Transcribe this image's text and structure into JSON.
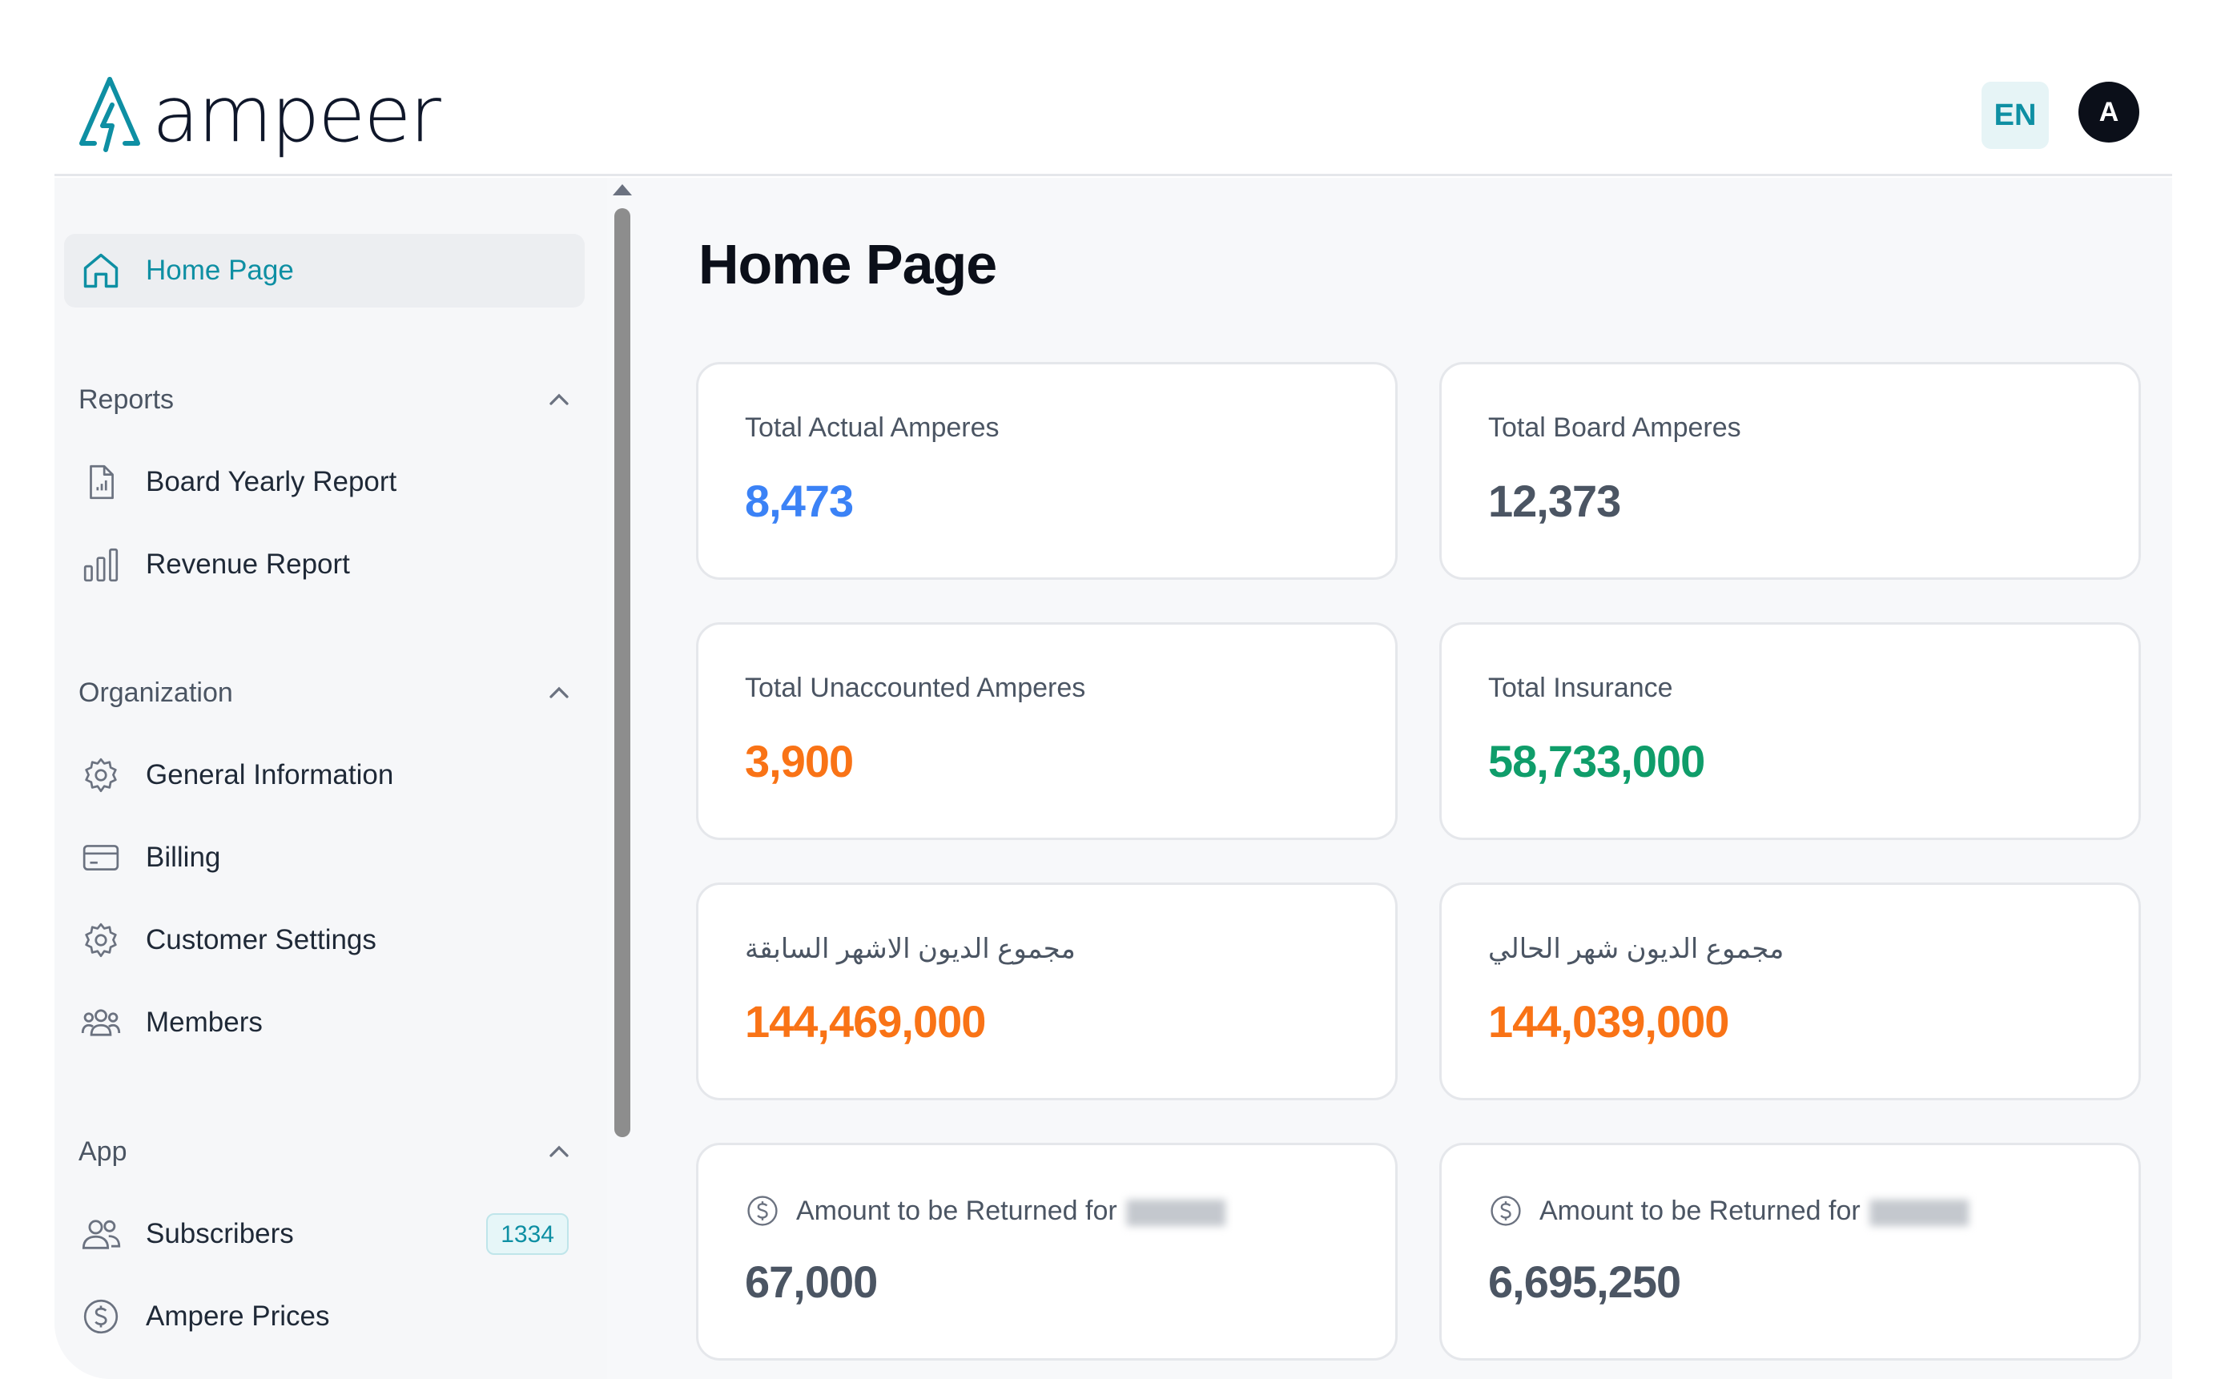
{
  "header": {
    "logo_text": "ampeer",
    "lang": "EN",
    "avatar_initial": "A"
  },
  "sidebar": {
    "home": "Home Page",
    "sections": [
      {
        "title": "Reports",
        "items": [
          {
            "label": "Board Yearly Report",
            "icon": "report-file-icon"
          },
          {
            "label": "Revenue Report",
            "icon": "bar-chart-icon"
          }
        ]
      },
      {
        "title": "Organization",
        "items": [
          {
            "label": "General Information",
            "icon": "gear-icon"
          },
          {
            "label": "Billing",
            "icon": "credit-card-icon"
          },
          {
            "label": "Customer Settings",
            "icon": "gear-icon"
          },
          {
            "label": "Members",
            "icon": "users-group-icon"
          }
        ]
      },
      {
        "title": "App",
        "items": [
          {
            "label": "Subscribers",
            "icon": "users-icon",
            "badge": "1334"
          },
          {
            "label": "Ampere Prices",
            "icon": "dollar-icon"
          }
        ]
      }
    ]
  },
  "main": {
    "title": "Home Page",
    "cards": [
      {
        "label": "Total Actual Amperes",
        "value": "8,473",
        "color": "#3b82f6"
      },
      {
        "label": "Total Board Amperes",
        "value": "12,373",
        "color": "#4b5563"
      },
      {
        "label": "Total Unaccounted Amperes",
        "value": "3,900",
        "color": "#f97316"
      },
      {
        "label": "Total Insurance",
        "value": "58,733,000",
        "color": "#0f9d6a"
      },
      {
        "label": "مجموع الديون الاشهر السابقة",
        "value": "144,469,000",
        "color": "#f97316"
      },
      {
        "label": "مجموع الديون شهر الحالي",
        "value": "144,039,000",
        "color": "#f97316"
      },
      {
        "label": "Amount to be Returned for",
        "value": "67,000",
        "color": "#4b5563"
      },
      {
        "label": "Amount to be Returned for",
        "value": "6,695,250",
        "color": "#4b5563"
      }
    ]
  }
}
